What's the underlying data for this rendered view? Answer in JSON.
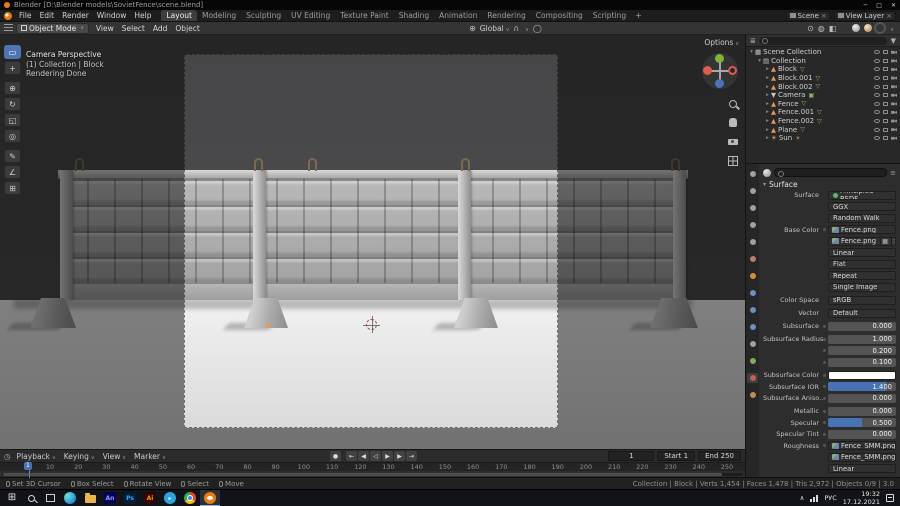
{
  "titlebar": {
    "title": "Blender  [D:\\Blender models\\SovietFence\\scene.blend]",
    "window_controls": [
      "─",
      "□",
      "✕"
    ]
  },
  "topbar": {
    "menus": [
      "File",
      "Edit",
      "Render",
      "Window",
      "Help"
    ],
    "workspaces": [
      "Layout",
      "Modeling",
      "Sculpting",
      "UV Editing",
      "Texture Paint",
      "Shading",
      "Animation",
      "Rendering",
      "Compositing",
      "Scripting"
    ],
    "active_workspace": "Layout",
    "new_workspace_button": "+",
    "scene_field": {
      "label": "Scene"
    },
    "view_layer_field": {
      "label": "View Layer"
    }
  },
  "tool_header": {
    "mode_select": "Object Mode",
    "menus": [
      "View",
      "Select",
      "Add",
      "Object"
    ],
    "orientation_select": "Global",
    "right_icons": [
      "show-gizmo",
      "show-overlays",
      "toggle-xray",
      "shading-wireframe",
      "shading-solid",
      "shading-material-preview",
      "shading-rendered"
    ],
    "active_shading": "shading-rendered",
    "options_button": "Options"
  },
  "viewport": {
    "hud": {
      "line1": "Camera Perspective",
      "line2": "(1) Collection | Block",
      "line3": "Rendering Done"
    },
    "tools": [
      "select-box-tool",
      "cursor-tool",
      "move-tool",
      "rotate-tool",
      "scale-tool",
      "transform-tool",
      "annotate-tool",
      "measure-tool",
      "add-cube-tool"
    ],
    "active_tool": "select-box-tool",
    "nav": [
      "zoom-control",
      "pan-control",
      "camera-view-control",
      "toggle-ortho-control"
    ],
    "gizmo_axes": [
      "X",
      "Y",
      "Z"
    ]
  },
  "outliner": {
    "rows": [
      {
        "label": "Scene Collection",
        "type": "scene",
        "depth": 0,
        "expanded": true
      },
      {
        "label": "Collection",
        "type": "collection",
        "depth": 1,
        "expanded": true
      },
      {
        "label": "Block",
        "type": "mesh",
        "depth": 2
      },
      {
        "label": "Block.001",
        "type": "mesh",
        "depth": 2
      },
      {
        "label": "Block.002",
        "type": "mesh",
        "depth": 2
      },
      {
        "label": "Camera",
        "type": "camera",
        "depth": 2
      },
      {
        "label": "Fence",
        "type": "mesh",
        "depth": 2
      },
      {
        "label": "Fence.001",
        "type": "mesh",
        "depth": 2
      },
      {
        "label": "Fence.002",
        "type": "mesh",
        "depth": 2
      },
      {
        "label": "Plane",
        "type": "mesh",
        "depth": 2
      },
      {
        "label": "Sun",
        "type": "light",
        "depth": 2
      }
    ]
  },
  "properties": {
    "tabs": [
      "tool",
      "render",
      "output",
      "view-layer",
      "scene",
      "world",
      "object",
      "modifiers",
      "particles",
      "physics",
      "constraints",
      "data",
      "material",
      "texture"
    ],
    "active_tab": "material",
    "section_title": "Surface",
    "rows": [
      {
        "label": "Surface",
        "value": "Principled BSDF",
        "kind": "shader"
      },
      {
        "label": "",
        "value": "GGX",
        "kind": "dropdown"
      },
      {
        "label": "",
        "value": "Random Walk",
        "kind": "dropdown"
      },
      {
        "label": "Base Color",
        "value": "Fence.png",
        "kind": "image"
      },
      {
        "label": "",
        "value": "Fence.png",
        "kind": "datablock"
      },
      {
        "label": "",
        "value": "Linear",
        "kind": "dropdown"
      },
      {
        "label": "",
        "value": "Flat",
        "kind": "dropdown"
      },
      {
        "label": "",
        "value": "Repeat",
        "kind": "dropdown"
      },
      {
        "label": "",
        "value": "Single Image",
        "kind": "dropdown"
      },
      {
        "label": "Color Space",
        "value": "sRGB",
        "kind": "dropdown",
        "gap": true
      },
      {
        "label": "Vector",
        "value": "Default",
        "kind": "dropdown",
        "gap": true
      },
      {
        "label": "Subsurface",
        "value": "0.000",
        "kind": "slider",
        "fill": 0,
        "gap": true
      },
      {
        "label": "Subsurface Radius",
        "value": "1.000",
        "kind": "slider",
        "fill": 0,
        "gap": true
      },
      {
        "label": "",
        "value": "0.200",
        "kind": "slider",
        "fill": 0
      },
      {
        "label": "",
        "value": "0.100",
        "kind": "slider",
        "fill": 0
      },
      {
        "label": "Subsurface Color",
        "value": "",
        "kind": "color",
        "swatch": "#ffffff",
        "gap": true
      },
      {
        "label": "Subsurface IOR",
        "value": "1.400",
        "kind": "slider",
        "fill": 0.85
      },
      {
        "label": "Subsurface Aniso..",
        "value": "0.000",
        "kind": "slider",
        "fill": 0
      },
      {
        "label": "Metallic",
        "value": "0.000",
        "kind": "slider",
        "fill": 0,
        "gap": true
      },
      {
        "label": "Specular",
        "value": "0.500",
        "kind": "slider",
        "fill": 0.5
      },
      {
        "label": "Specular Tint",
        "value": "0.000",
        "kind": "slider",
        "fill": 0
      },
      {
        "label": "Roughness",
        "value": "Fence_SMM.png",
        "kind": "image"
      },
      {
        "label": "",
        "value": "Fence_SMM.png",
        "kind": "datablock"
      },
      {
        "label": "",
        "value": "Linear",
        "kind": "dropdown"
      }
    ]
  },
  "timeline": {
    "menus": [
      "Playback",
      "Keying",
      "View",
      "Marker"
    ],
    "playback_buttons": [
      "auto-keyframe",
      "jump-to-start",
      "prev-keyframe",
      "play-reverse",
      "play",
      "next-keyframe",
      "jump-to-end"
    ],
    "ticks": [
      10,
      20,
      30,
      40,
      50,
      60,
      70,
      80,
      90,
      100,
      110,
      120,
      130,
      140,
      150,
      160,
      170,
      180,
      190,
      200,
      210,
      220,
      230,
      240,
      250
    ],
    "current_frame": "1",
    "frame_field": "1",
    "start_field": "Start 1",
    "end_field": "End 250"
  },
  "statusbar": {
    "hints": [
      "Set 3D Cursor",
      "Box Select",
      "Rotate View",
      "Select",
      "Move"
    ],
    "stats": "Collection | Block | Verts 1,454 | Faces 1,478 | Tris 2,972 | Objects 0/9 | 3.0"
  },
  "taskbar": {
    "apps": [
      {
        "name": "edge"
      },
      {
        "name": "folder"
      },
      {
        "name": "animate",
        "label": "An"
      },
      {
        "name": "photoshop",
        "label": "Ps"
      },
      {
        "name": "illustrator",
        "label": "Ai"
      },
      {
        "name": "telegram"
      },
      {
        "name": "chrome"
      },
      {
        "name": "blender",
        "active": true
      }
    ],
    "tray": {
      "lang": "РУС",
      "time": "19:32",
      "date": "17.12.2021"
    }
  },
  "colors": {
    "accent": "#4772b4",
    "selection_orange": "#e87d0d"
  }
}
